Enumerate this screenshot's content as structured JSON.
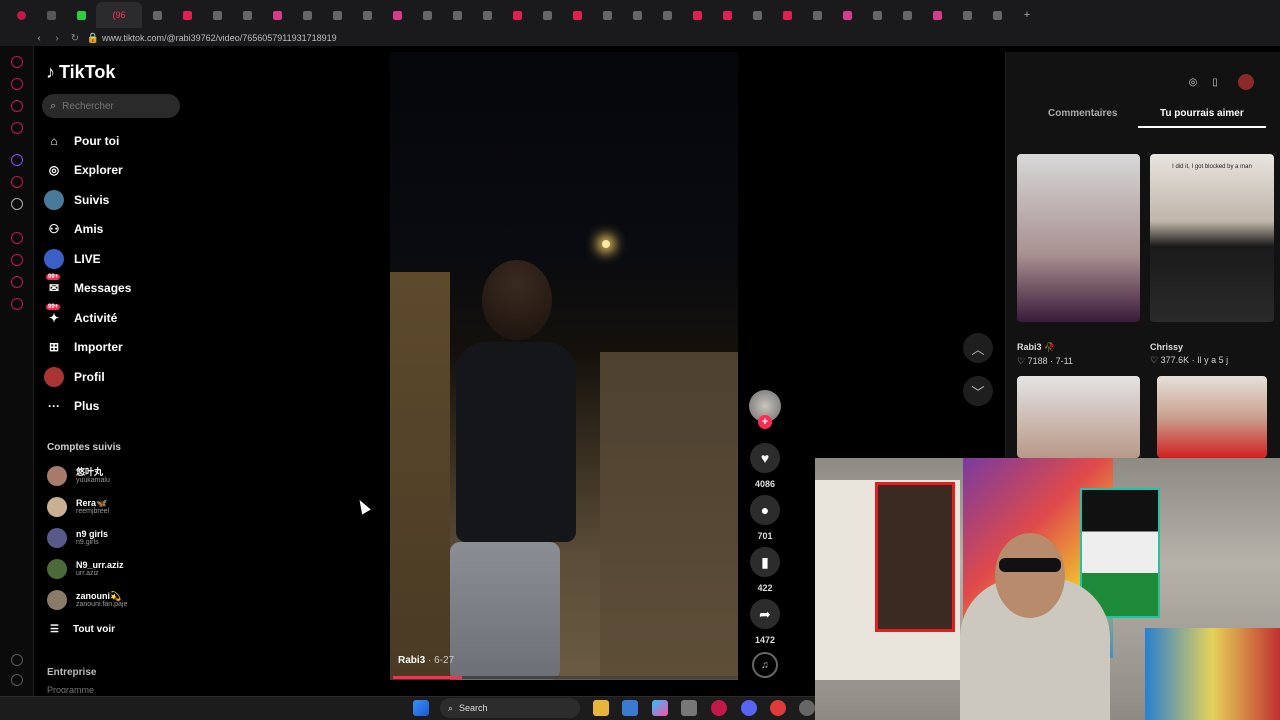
{
  "browser": {
    "url": "www.tiktok.com/@rabi39762/video/7656057911931718919",
    "active_tab_label": "(96",
    "colors": {
      "accent": "#fe2c55",
      "opera": "#c3184a"
    }
  },
  "tiktok": {
    "brand": "TikTok",
    "search_placeholder": "Rechercher",
    "nav": [
      {
        "label": "Pour toi",
        "icon": "home-icon"
      },
      {
        "label": "Explorer",
        "icon": "compass-icon"
      },
      {
        "label": "Suivis",
        "icon": "avatar-icon"
      },
      {
        "label": "Amis",
        "icon": "friends-icon"
      },
      {
        "label": "LIVE",
        "icon": "live-icon"
      },
      {
        "label": "Messages",
        "icon": "message-icon",
        "badge": "99+"
      },
      {
        "label": "Activité",
        "icon": "activity-icon",
        "badge": "99+"
      },
      {
        "label": "Importer",
        "icon": "upload-icon"
      },
      {
        "label": "Profil",
        "icon": "profile-icon"
      },
      {
        "label": "Plus",
        "icon": "more-icon"
      }
    ],
    "accounts_title": "Comptes suivis",
    "accounts": [
      {
        "name": "悠叶丸",
        "handle": "yuukamalu"
      },
      {
        "name": "Rera🦋",
        "handle": "reemjbreel"
      },
      {
        "name": "n9 girls",
        "handle": "n9.girls"
      },
      {
        "name": "N9_urr.aziz",
        "handle": "urr.aziz"
      },
      {
        "name": "zanouni💫",
        "handle": "zanouni.fan.paje"
      }
    ],
    "see_all": "Tout voir",
    "footer_title": "Entreprise",
    "footer_sub": "Programme"
  },
  "video": {
    "author": "Rabi3",
    "date": "· 6-27",
    "progress": 0.2,
    "likes": "4086",
    "comments": "701",
    "saves": "422",
    "shares": "1472",
    "follow_symbol": "+"
  },
  "right_panel": {
    "tab_comments": "Commentaires",
    "tab_suggested": "Tu pourrais aimer",
    "items": [
      {
        "author": "Rabi3 🥀",
        "stats": "♡ 7188 · 7-11"
      },
      {
        "author": "Chrissy",
        "stats": "♡ 377.6K · Il y a 5 j",
        "overlay": "I did it, I got blocked by a man"
      }
    ]
  },
  "taskbar": {
    "search_label": "Search"
  }
}
